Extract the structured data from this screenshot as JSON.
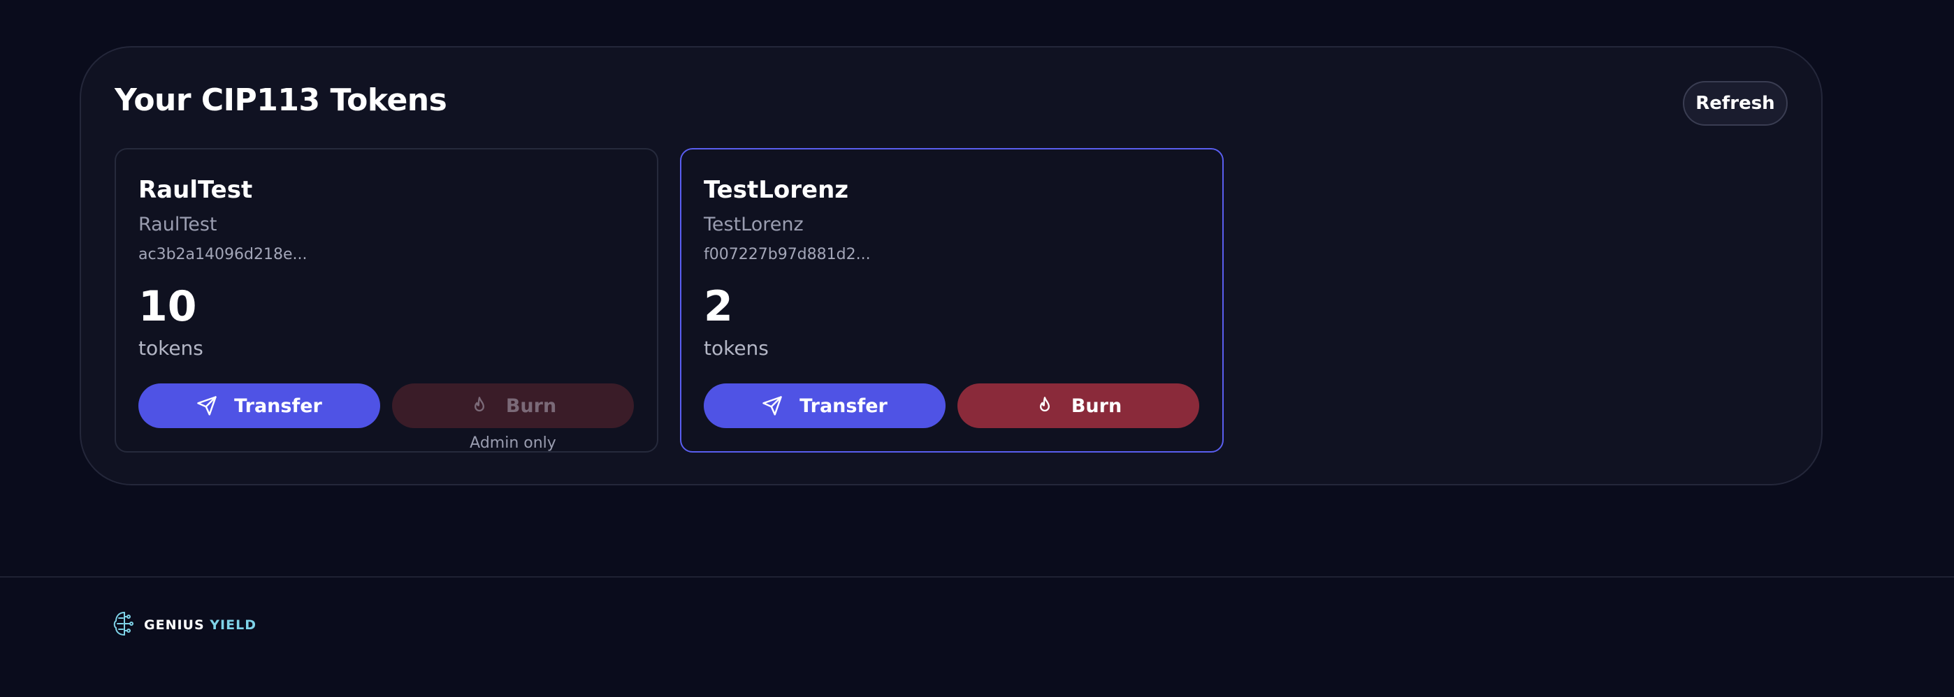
{
  "panel": {
    "title": "Your CIP113 Tokens",
    "refresh_label": "Refresh"
  },
  "tokens": [
    {
      "name": "RaulTest",
      "subname": "RaulTest",
      "id": "ac3b2a14096d218e...",
      "amount": "10",
      "unit": "tokens",
      "transfer_label": "Transfer",
      "burn_label": "Burn",
      "burn_enabled": false,
      "burn_note": "Admin only"
    },
    {
      "name": "TestLorenz",
      "subname": "TestLorenz",
      "id": "f007227b97d881d2...",
      "amount": "2",
      "unit": "tokens",
      "transfer_label": "Transfer",
      "burn_label": "Burn",
      "burn_enabled": true
    }
  ],
  "footer": {
    "logo_word_1": "GENIUS",
    "logo_word_2": "YIELD"
  },
  "icons": {
    "transfer": "send-icon",
    "burn": "flame-icon",
    "logo": "brain-circuit-icon"
  },
  "colors": {
    "background": "#0a0c1c",
    "primary": "#4f53e5",
    "danger": "#8a2a3a",
    "selected_border": "#5a5ef0",
    "logo_accent": "#7fd3e8"
  }
}
